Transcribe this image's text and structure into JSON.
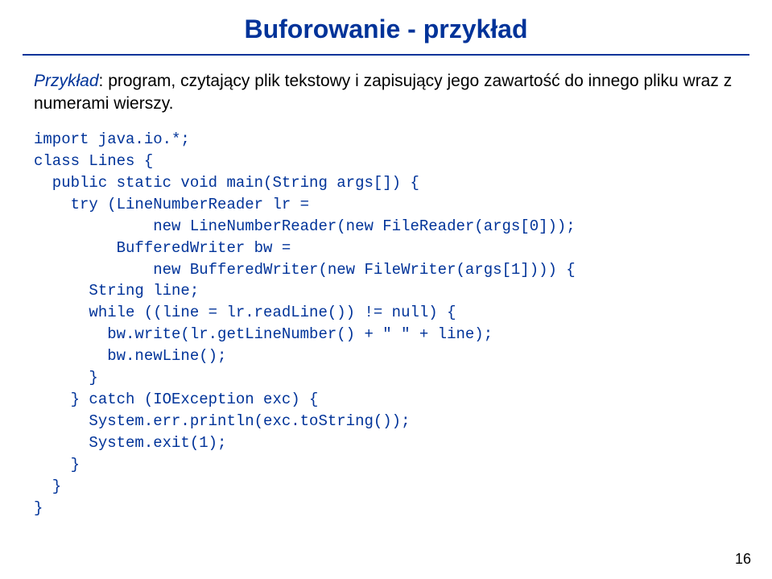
{
  "title": "Buforowanie - przykład",
  "intro_label": "Przykład",
  "intro_text": ": program, czytający plik tekstowy i zapisujący jego zawartość do innego pliku wraz z numerami wierszy.",
  "code": "import java.io.*;\nclass Lines {\n  public static void main(String args[]) {\n    try (LineNumberReader lr =\n             new LineNumberReader(new FileReader(args[0]));\n         BufferedWriter bw =\n             new BufferedWriter(new FileWriter(args[1]))) {\n      String line;\n      while ((line = lr.readLine()) != null) {\n        bw.write(lr.getLineNumber() + \" \" + line);\n        bw.newLine();\n      }\n    } catch (IOException exc) {\n      System.err.println(exc.toString());\n      System.exit(1);\n    }\n  }\n}",
  "page_number": "16"
}
